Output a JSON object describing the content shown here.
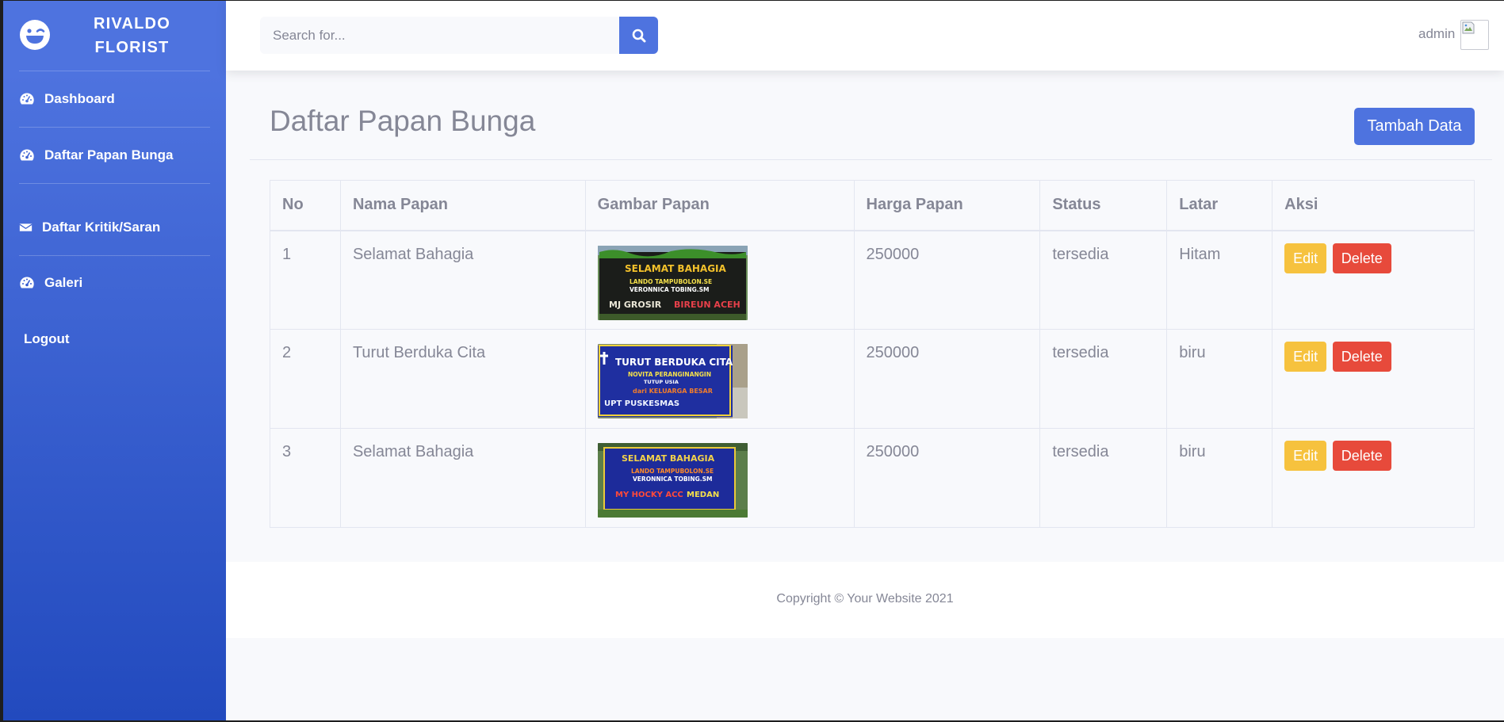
{
  "sidebar": {
    "brand": "RIVALDO FLORIST",
    "brand_icon": "laugh-wink-icon",
    "items": [
      {
        "label": "Dashboard",
        "icon": "tachometer-icon"
      },
      {
        "label": "Daftar Papan Bunga",
        "icon": "tachometer-icon"
      },
      {
        "label": "Daftar Kritik/Saran",
        "icon": "envelope-icon"
      },
      {
        "label": "Galeri",
        "icon": "tachometer-icon"
      },
      {
        "label": "Logout",
        "icon": ""
      }
    ]
  },
  "topbar": {
    "search_placeholder": "Search for...",
    "search_icon": "search-icon",
    "user_name": "admin"
  },
  "main": {
    "title": "Daftar Papan Bunga",
    "add_button": "Tambah Data",
    "table": {
      "columns": [
        "No",
        "Nama Papan",
        "Gambar Papan",
        "Harga Papan",
        "Status",
        "Latar",
        "Aksi"
      ],
      "rows": [
        {
          "no": "1",
          "nama": "Selamat Bahagia",
          "harga": "250000",
          "status": "tersedia",
          "latar": "Hitam",
          "image": {
            "line1": "SELAMAT BAHAGIA",
            "line2": "LANDO TAMPUBOLON.SE",
            "line3": "VERONNICA TOBING.SM",
            "line4": "MJ GROSIR",
            "line5": "BIREUN ACEH"
          }
        },
        {
          "no": "2",
          "nama": "Turut Berduka Cita",
          "harga": "250000",
          "status": "tersedia",
          "latar": "biru",
          "image": {
            "line1": "TURUT BERDUKA CITA",
            "line2": "NOVITA PERANGINANGIN",
            "line3": "TUTUP USIA",
            "line4": "dari KELUARGA BESAR",
            "line5": "UPT PUSKESMAS"
          }
        },
        {
          "no": "3",
          "nama": "Selamat Bahagia",
          "harga": "250000",
          "status": "tersedia",
          "latar": "biru",
          "image": {
            "line1": "SELAMAT BAHAGIA",
            "line2": "LANDO TAMPUBOLON.SE",
            "line3": "VERONNICA TOBING.SM",
            "line4": "MY HOCKY ACC",
            "line5": "MEDAN"
          }
        }
      ],
      "edit_label": "Edit",
      "delete_label": "Delete"
    }
  },
  "footer": {
    "copyright": "Copyright © Your Website 2021"
  },
  "colors": {
    "primary": "#4e73df",
    "warning": "#f6c23e",
    "danger": "#e74a3b",
    "text_gray": "#858796"
  }
}
